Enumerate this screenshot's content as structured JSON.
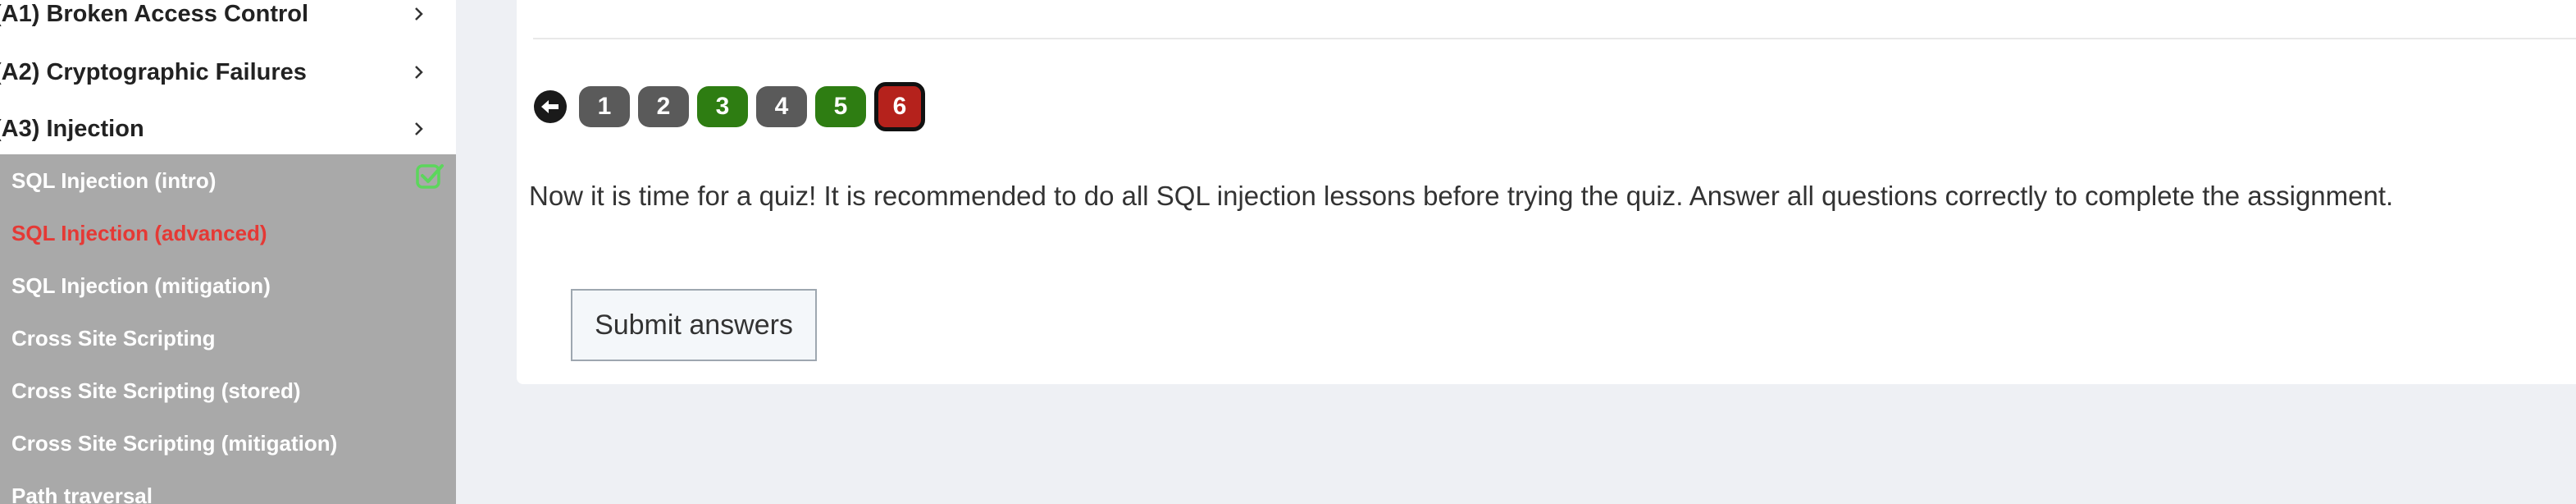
{
  "sidebar": {
    "categories": [
      {
        "label": "(A1) Broken Access Control"
      },
      {
        "label": "(A2) Cryptographic Failures"
      },
      {
        "label": "(A3) Injection"
      }
    ],
    "items": [
      {
        "label": "SQL Injection (intro)",
        "completed": true
      },
      {
        "label": "SQL Injection (advanced)",
        "active": true
      },
      {
        "label": "SQL Injection (mitigation)"
      },
      {
        "label": "Cross Site Scripting"
      },
      {
        "label": "Cross Site Scripting (stored)"
      },
      {
        "label": "Cross Site Scripting (mitigation)"
      },
      {
        "label": "Path traversal"
      }
    ]
  },
  "pager": {
    "pages": [
      {
        "label": "1",
        "state": "grey"
      },
      {
        "label": "2",
        "state": "grey"
      },
      {
        "label": "3",
        "state": "green"
      },
      {
        "label": "4",
        "state": "grey"
      },
      {
        "label": "5",
        "state": "green"
      },
      {
        "label": "6",
        "state": "current"
      }
    ]
  },
  "content": {
    "intro_text": "Now it is time for a quiz! It is recommended to do all SQL injection lessons before trying the quiz. Answer all questions correctly to complete the assignment.",
    "submit_label": "Submit answers"
  },
  "colors": {
    "active_item": "#e53935",
    "completed_check": "#5cd65c",
    "page_grey": "#5a5a5a",
    "page_green": "#2e7d12",
    "page_current": "#b5221c"
  }
}
